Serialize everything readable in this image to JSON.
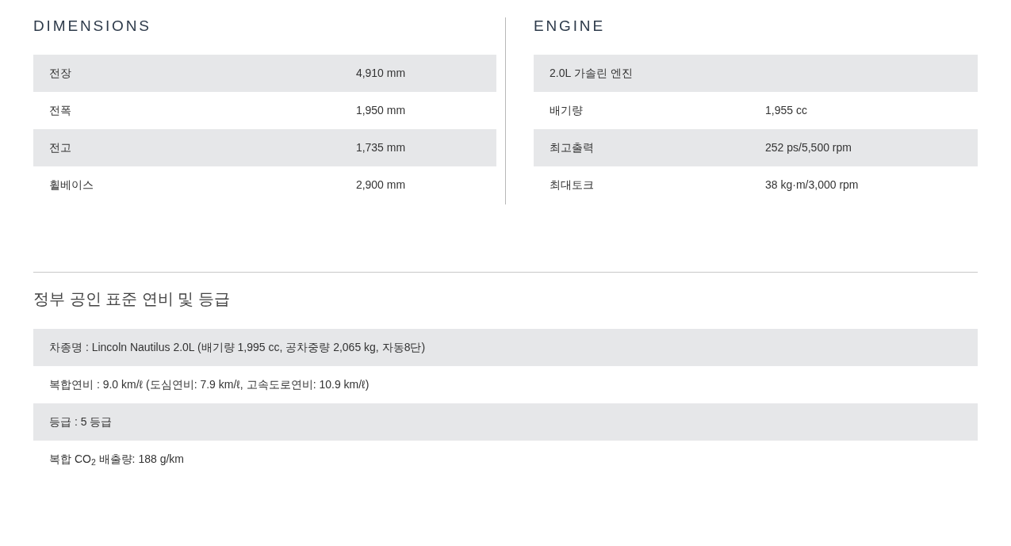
{
  "dimensions": {
    "title": "DIMENSIONS",
    "rows": [
      {
        "label": "전장",
        "value": "4,910 mm"
      },
      {
        "label": "전폭",
        "value": "1,950 mm"
      },
      {
        "label": "전고",
        "value": "1,735 mm"
      },
      {
        "label": "휠베이스",
        "value": "2,900 mm"
      }
    ]
  },
  "engine": {
    "title": "ENGINE",
    "rows": [
      {
        "kind": "heading",
        "label": "2.0L 가솔린 엔진"
      },
      {
        "kind": "spec",
        "label": "배기량",
        "value": "1,955 cc"
      },
      {
        "kind": "spec",
        "label": "최고출력",
        "value": "252 ps/5,500 rpm"
      },
      {
        "kind": "spec",
        "label": "최대토크",
        "value": "38 kg·m/3,000 rpm"
      }
    ]
  },
  "fuel_economy": {
    "title": "정부 공인 표준 연비 및 등급",
    "rows": [
      "차종명 : Lincoln Nautilus 2.0L (배기량 1,995 cc, 공차중량 2,065 kg, 자동8단)",
      "복합연비 : 9.0 km/ℓ (도심연비: 7.9 km/ℓ, 고속도로연비: 10.9 km/ℓ)",
      "등급 : 5 등급",
      "복합 CO$_{2}$ 배출량: 188 g/km"
    ]
  }
}
